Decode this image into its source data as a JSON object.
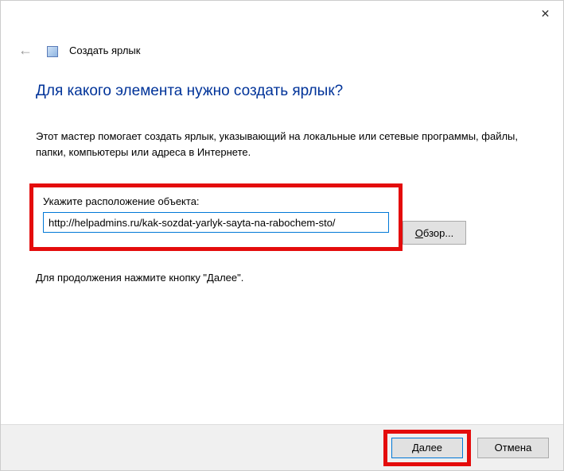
{
  "titlebar": {
    "close_symbol": "✕"
  },
  "header": {
    "back_symbol": "←",
    "wizard_name": "Создать ярлык"
  },
  "main": {
    "heading": "Для какого элемента нужно создать ярлык?",
    "description": "Этот мастер помогает создать ярлык, указывающий на локальные или сетевые программы, файлы, папки, компьютеры или адреса в Интернете.",
    "field_label": "Укажите расположение объекта:",
    "location_value": "http://helpadmins.ru/kak-sozdat-yarlyk-sayta-na-rabochem-sto/",
    "browse_accel": "О",
    "browse_rest": "бзор...",
    "continue_text": "Для продолжения нажмите кнопку \"Далее\"."
  },
  "footer": {
    "next_accel": "Д",
    "next_rest": "алее",
    "cancel_label": "Отмена"
  }
}
